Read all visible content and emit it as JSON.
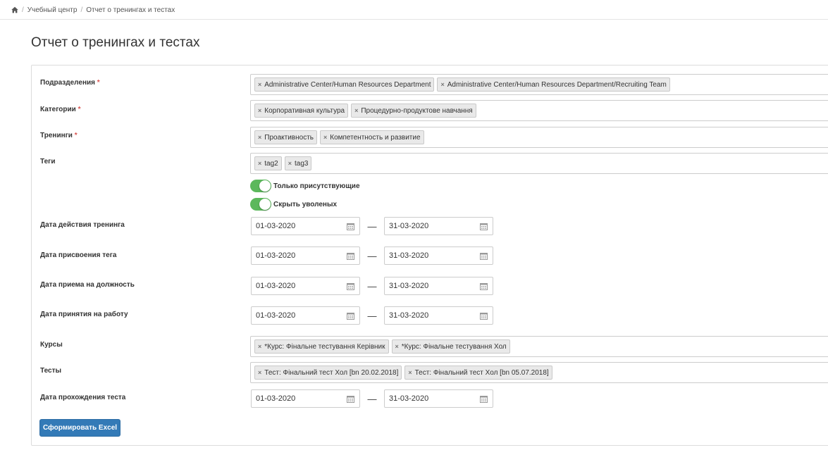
{
  "breadcrumb": {
    "items": [
      "Учебный центр",
      "Отчет о тренингах и тестах"
    ]
  },
  "page_title": "Отчет о тренингах и тестах",
  "fields": {
    "departments": {
      "label": "Подразделения",
      "required": "*",
      "tags": [
        "Administrative Center/Human Resources Department",
        "Administrative Center/Human Resources Department/Recruiting Team"
      ]
    },
    "categories": {
      "label": "Категории",
      "required": "*",
      "tags": [
        "Корпоративная культура",
        "Процедурно-продуктове навчання"
      ]
    },
    "trainings": {
      "label": "Тренинги",
      "required": "*",
      "tags": [
        "Проактивность",
        "Компетентность и развитие"
      ]
    },
    "tags": {
      "label": "Теги",
      "tags": [
        "tag2",
        "tag3"
      ]
    },
    "only_present": {
      "label": "Только присутствующие",
      "checked": true
    },
    "hide_dismissed": {
      "label": "Скрыть уволеных",
      "checked": true
    },
    "training_date": {
      "label": "Дата действия тренинга",
      "from": "01-03-2020",
      "to": "31-03-2020"
    },
    "tag_date": {
      "label": "Дата присвоения тега",
      "from": "01-03-2020",
      "to": "31-03-2020"
    },
    "position_date": {
      "label": "Дата приема на должность",
      "from": "01-03-2020",
      "to": "31-03-2020"
    },
    "hire_date": {
      "label": "Дата принятия на работу",
      "from": "01-03-2020",
      "to": "31-03-2020"
    },
    "courses": {
      "label": "Курсы",
      "tags": [
        "*Курс: Фінальне тестування Керівник",
        "*Курс: Фінальне тестування Хол"
      ]
    },
    "tests": {
      "label": "Тесты",
      "tags": [
        "Тест: Фінальний тест Хол [bn 20.02.2018]",
        "Тест: Фінальний тест Хол [bn 05.07.2018]"
      ]
    },
    "test_date": {
      "label": "Дата прохождения теста",
      "from": "01-03-2020",
      "to": "31-03-2020"
    }
  },
  "remove_glyph": "×",
  "range_dash": "—",
  "submit_label": "Сформировать Excel",
  "colors": {
    "toggle_on": "#5cb85c",
    "primary": "#337ab7",
    "required": "#d9534f"
  }
}
